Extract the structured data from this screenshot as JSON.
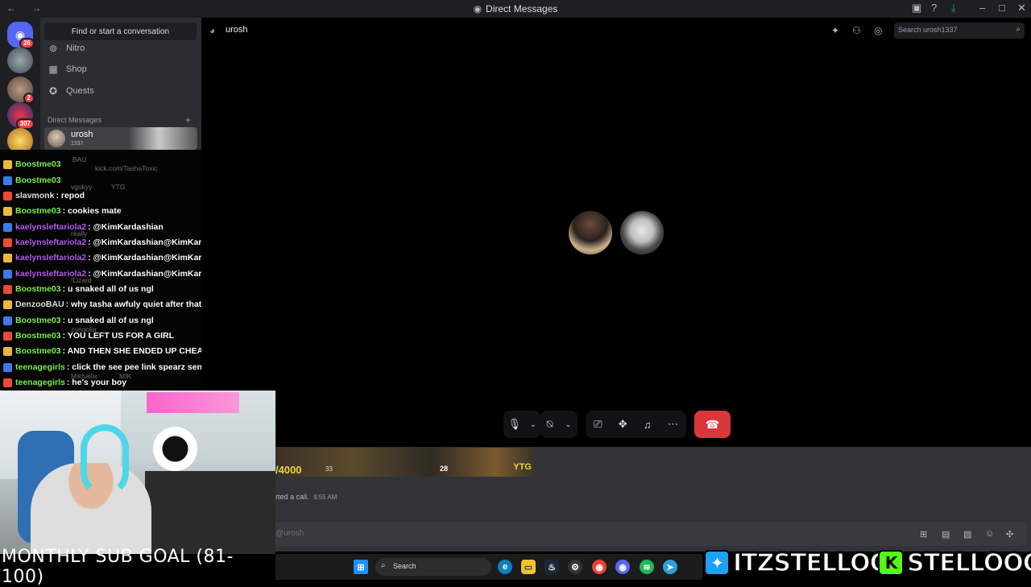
{
  "window": {
    "title": "Direct Messages"
  },
  "servers": [
    {
      "badge": "26"
    },
    {
      "badge": ""
    },
    {
      "badge": "2"
    },
    {
      "badge": "307"
    },
    {
      "badge": ""
    }
  ],
  "sidebar": {
    "find_placeholder": "Find or start a conversation",
    "nav": [
      {
        "label": "Nitro",
        "icon": "nitro-icon"
      },
      {
        "label": "Shop",
        "icon": "shop-icon"
      },
      {
        "label": "Quests",
        "icon": "quests-icon"
      }
    ],
    "dm_header": "Direct Messages",
    "dm": {
      "name": "urosh",
      "sub": "1337"
    }
  },
  "chat_overlay": {
    "lines": [
      {
        "user": "Boostme03",
        "color": "#7cf04a",
        "text": ""
      },
      {
        "user": "Boostme03",
        "color": "#7cf04a",
        "text": ""
      },
      {
        "user": "slavmonk",
        "color": "#e0e0e0",
        "text": ": repod"
      },
      {
        "user": "Boostme03",
        "color": "#7cf04a",
        "text": ": cookies mate"
      },
      {
        "user": "kaelynsleftariola2",
        "color": "#b45cf0",
        "text": ": @KimKardashian"
      },
      {
        "user": "kaelynsleftariola2",
        "color": "#b45cf0",
        "text": ": @KimKardashian@KimKardashian"
      },
      {
        "user": "kaelynsleftariola2",
        "color": "#b45cf0",
        "text": ": @KimKardashian@KimKardashian"
      },
      {
        "user": "kaelynsleftariola2",
        "color": "#b45cf0",
        "text": ": @KimKardashian@KimKardashian"
      },
      {
        "user": "Boostme03",
        "color": "#7cf04a",
        "text": ": u snaked all of us ngl"
      },
      {
        "user": "DenzooBAU",
        "color": "#e0e0e0",
        "text": ": why tasha awfuly quiet after that mail"
      },
      {
        "user": "Boostme03",
        "color": "#7cf04a",
        "text": ": u snaked all of us ngl"
      },
      {
        "user": "Boostme03",
        "color": "#7cf04a",
        "text": ": YOU LEFT US FOR A GIRL"
      },
      {
        "user": "Boostme03",
        "color": "#7cf04a",
        "text": ": AND THEN SHE ENDED UP CHEATING ON YOU"
      },
      {
        "user": "teenagegirls",
        "color": "#7cf04a",
        "text": ": click the see pee link spearz sent"
      },
      {
        "user": "teenagegirls",
        "color": "#7cf04a",
        "text": ": he's your boy"
      }
    ],
    "ghost": [
      {
        "text": "kick.com/TashaToxic"
      },
      {
        "text": "vgukyy"
      },
      {
        "text": "YTG"
      },
      {
        "text": "BAU"
      },
      {
        "text": "really"
      },
      {
        "text": "!Lizard"
      },
      {
        "text": "zongolia"
      },
      {
        "text": "Mikhailis"
      },
      {
        "text": "MIK"
      }
    ]
  },
  "header": {
    "name": "urosh",
    "search_placeholder": "Search urosh1337"
  },
  "call": {
    "controls": [
      "microphone",
      "camera",
      "share-screen",
      "activities",
      "soundboard",
      "more"
    ]
  },
  "bottom": {
    "strip_number": "/4000",
    "strip_tag": "YTG",
    "strip_mid": "28",
    "strip_left": "33",
    "started_call": "rted a call.",
    "started_time": "9:55 AM",
    "message_placeholder": "@urosh"
  },
  "stream": {
    "subgoal": "MONTHLY SUB GOAL (81-100)",
    "twitter": "ITZSTELLOO",
    "kick": "STELLOOO"
  },
  "taskbar": {
    "search": "Search"
  },
  "colors": {
    "accent": "#5865f2",
    "danger": "#da373c"
  }
}
